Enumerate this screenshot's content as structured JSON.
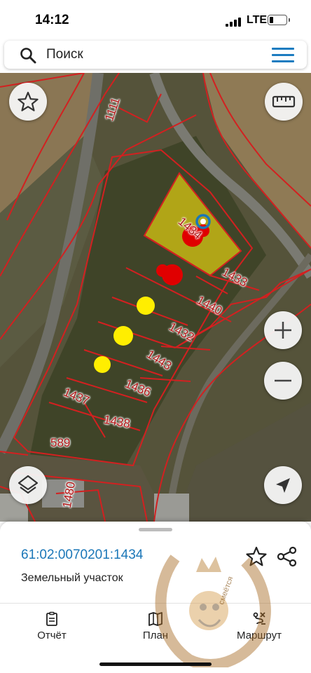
{
  "status_bar": {
    "time": "14:12",
    "network": "LTE"
  },
  "search": {
    "placeholder": "Поиск"
  },
  "map": {
    "parcel_labels": [
      "1111",
      "1434",
      "1433",
      "1440",
      "1432",
      "1443",
      "1436",
      "1437",
      "1438",
      "589",
      "1480"
    ],
    "parcel_border_color": "#d32020",
    "selected_fill_color": "#d4c21a",
    "marker_colors": {
      "red": "#e00000",
      "yellow": "#ffee00",
      "location": "#1b77b8"
    }
  },
  "parcel_info": {
    "cadastral_number": "61:02:0070201:1434",
    "type": "Земельный участок"
  },
  "tabs": [
    {
      "label": "Отчёт",
      "icon": "report-icon"
    },
    {
      "label": "План",
      "icon": "map-plan-icon"
    },
    {
      "label": "Маршрут",
      "icon": "route-icon"
    }
  ],
  "watermark": {
    "text": "смеётся"
  }
}
